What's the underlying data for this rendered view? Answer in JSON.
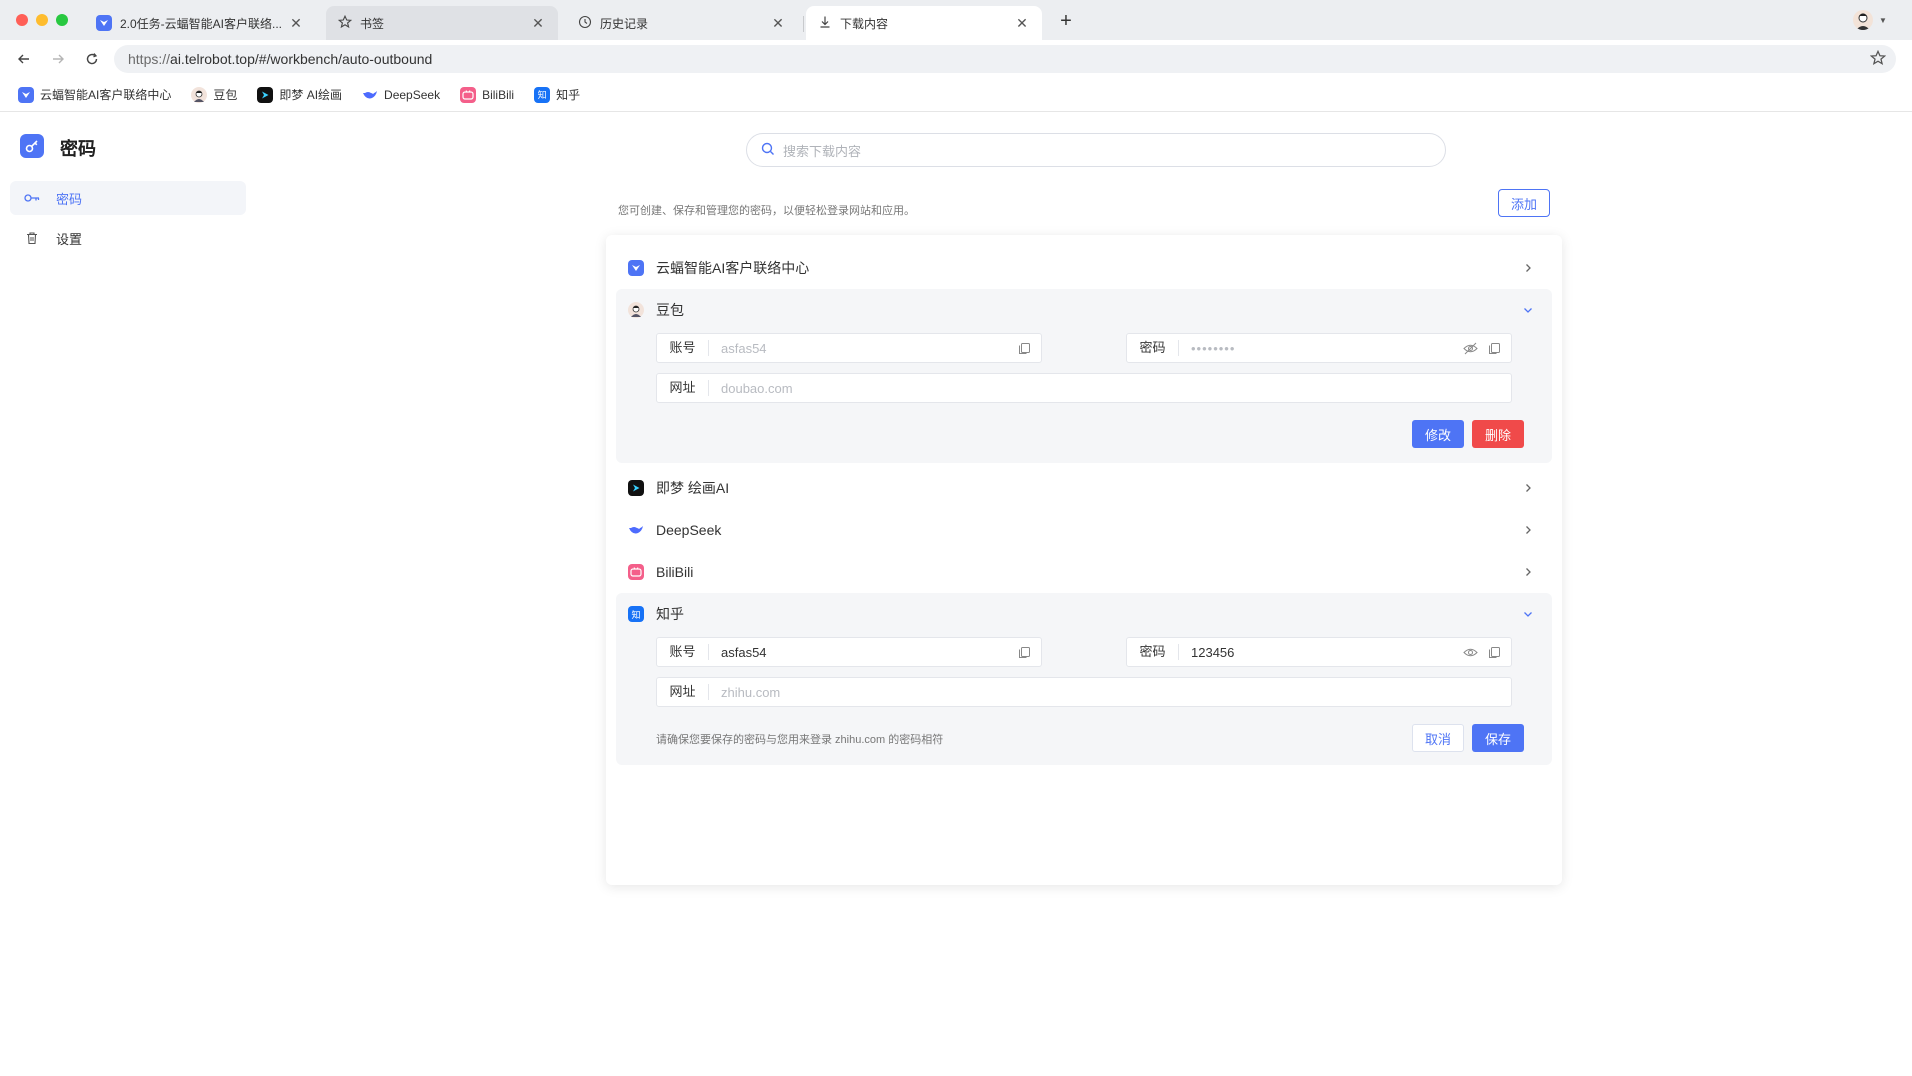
{
  "browser": {
    "tabs": [
      {
        "title": "2.0任务-云蝠智能AI客户联络...",
        "icon": "yunfu-favicon"
      },
      {
        "title": "书签",
        "icon": "star-icon"
      },
      {
        "title": "历史记录",
        "icon": "history-icon"
      },
      {
        "title": "下载内容",
        "icon": "download-icon"
      }
    ],
    "url_proto": "https://",
    "url_rest": "ai.telrobot.top/#/workbench/auto-outbound",
    "bookmarks": [
      {
        "label": "云蝠智能AI客户联络中心",
        "icon": "yunfu-favicon",
        "glyph": "▾"
      },
      {
        "label": "豆包",
        "icon": "doubao-favicon",
        "glyph": ""
      },
      {
        "label": "即梦 AI绘画",
        "icon": "jimeng-favicon",
        "glyph": "▶"
      },
      {
        "label": "DeepSeek",
        "icon": "deepseek-favicon",
        "glyph": ""
      },
      {
        "label": "BiliBili",
        "icon": "bilibili-favicon",
        "glyph": "▭"
      },
      {
        "label": "知乎",
        "icon": "zhihu-favicon",
        "glyph": "知"
      }
    ]
  },
  "app": {
    "title": "密码",
    "sidebar": [
      {
        "label": "密码",
        "icon": "key-icon",
        "active": true
      },
      {
        "label": "设置",
        "icon": "trash-icon",
        "active": false
      }
    ]
  },
  "search": {
    "placeholder": "搜索下载内容"
  },
  "description": "您可创建、保存和管理您的密码，以便轻松登录网站和应用。",
  "add_label": "添加",
  "labels": {
    "account": "账号",
    "password": "密码",
    "website": "网址",
    "edit": "修改",
    "delete": "删除",
    "cancel": "取消",
    "save": "保存"
  },
  "entries": [
    {
      "name": "云蝠智能AI客户联络中心",
      "icon": "yunfu-favicon",
      "expanded": false
    },
    {
      "name": "豆包",
      "icon": "doubao-favicon",
      "expanded": true,
      "account": "asfas54",
      "password_masked": "••••••••",
      "website": "doubao.com"
    },
    {
      "name": "即梦 绘画AI",
      "icon": "jimeng-favicon",
      "expanded": false
    },
    {
      "name": "DeepSeek",
      "icon": "deepseek-favicon",
      "expanded": false
    },
    {
      "name": "BiliBili",
      "icon": "bilibili-favicon",
      "expanded": false
    },
    {
      "name": "知乎",
      "icon": "zhihu-favicon",
      "expanded": true,
      "account": "asfas54",
      "password": "123456",
      "website": "zhihu.com",
      "hint": "请确保您要保存的密码与您用来登录 zhihu.com 的密码相符"
    }
  ],
  "colors": {
    "accent": "#4e74f5",
    "danger": "#f04a4a"
  }
}
